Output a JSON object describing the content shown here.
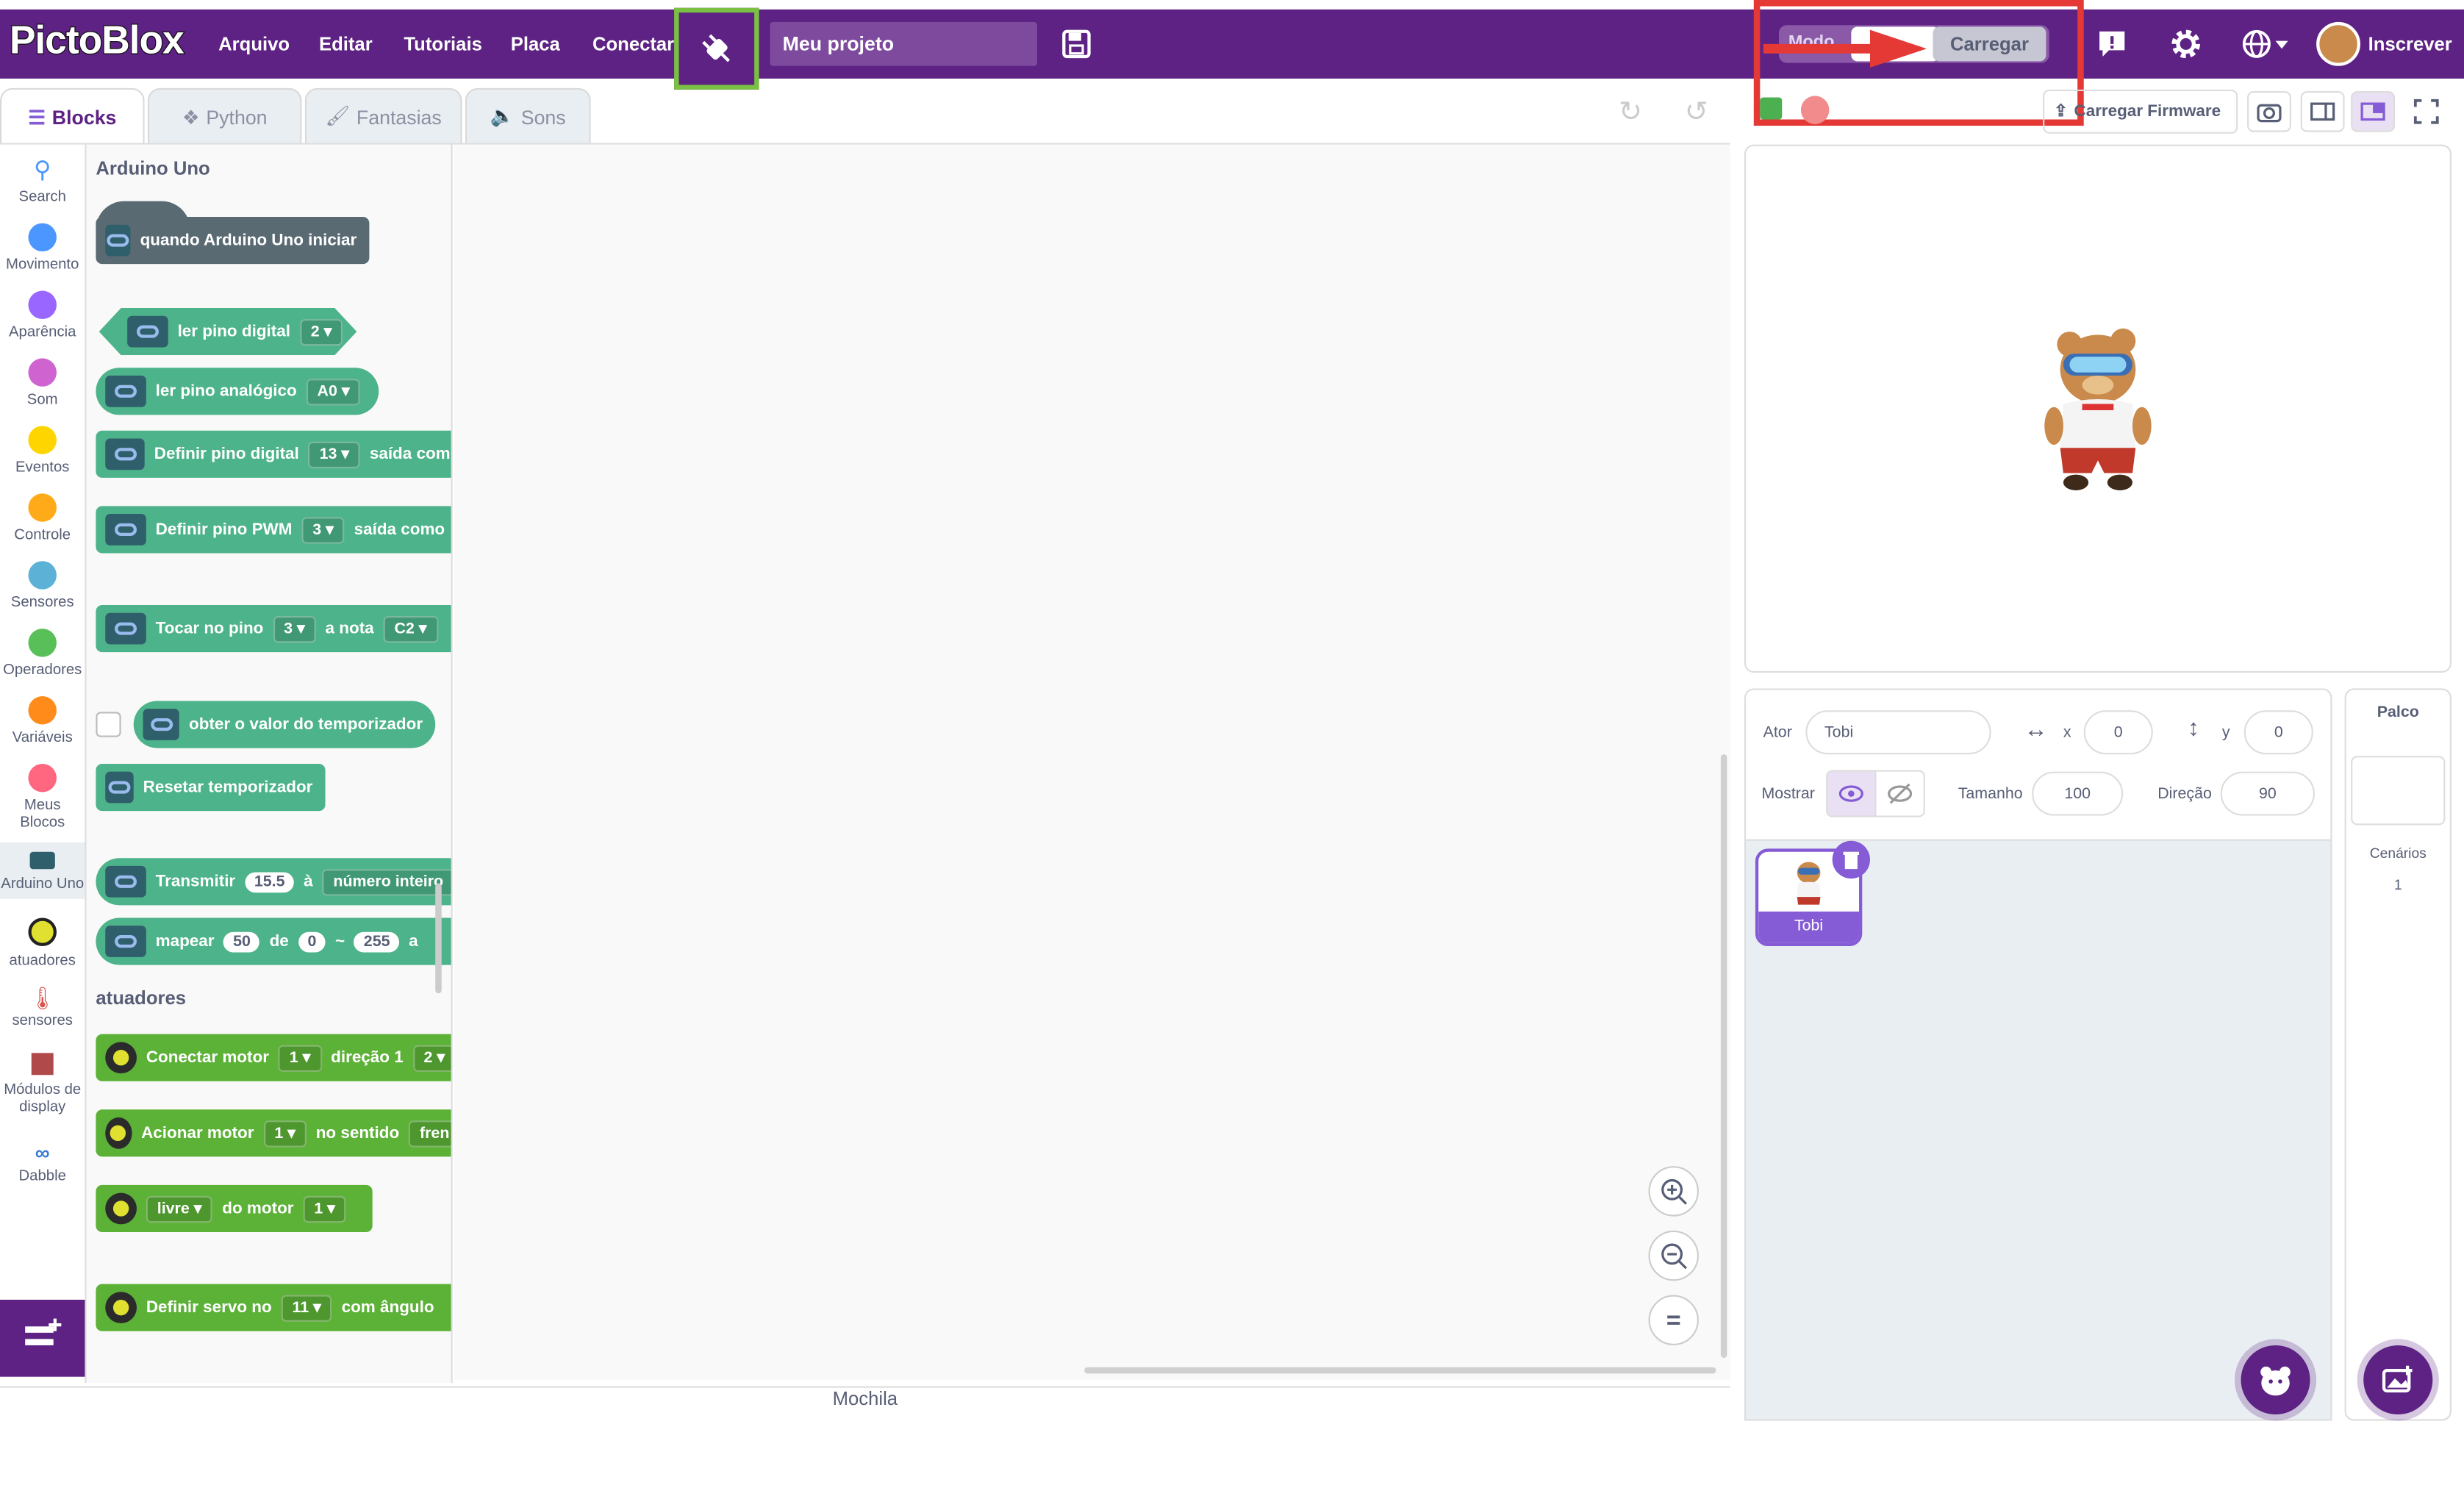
{
  "brand": {
    "logo": "PictoBlox"
  },
  "menu": {
    "file": "Arquivo",
    "edit": "Editar",
    "tutorials": "Tutoriais",
    "board": "Placa",
    "connect": "Conectar"
  },
  "project": {
    "name": "Meu projeto"
  },
  "mode": {
    "label": "Modo",
    "upload": "Carregar"
  },
  "account": {
    "signup": "Inscrever"
  },
  "tabs": {
    "blocks": "Blocks",
    "python": "Python",
    "costumes": "Fantasias",
    "sounds": "Sons"
  },
  "toolbar": {
    "upload_firmware": "Carregar Firmware"
  },
  "categories": [
    {
      "label": "Search",
      "color": "#4c97ff"
    },
    {
      "label": "Movimento",
      "color": "#4c97ff"
    },
    {
      "label": "Aparência",
      "color": "#9966ff"
    },
    {
      "label": "Som",
      "color": "#cf63cf"
    },
    {
      "label": "Eventos",
      "color": "#ffd500"
    },
    {
      "label": "Controle",
      "color": "#ffab19"
    },
    {
      "label": "Sensores",
      "color": "#5cb1d6"
    },
    {
      "label": "Operadores",
      "color": "#59c059"
    },
    {
      "label": "Variáveis",
      "color": "#ff8c1a"
    },
    {
      "label": "Meus Blocos",
      "color": "#ff6680"
    },
    {
      "label": "Arduino Uno",
      "color": "#2f5f6b"
    },
    {
      "label": "atuadores",
      "color": "#e0e030"
    },
    {
      "label": "sensores",
      "color": "#d9534f"
    },
    {
      "label": "Módulos de display",
      "color": "#b04a4a"
    },
    {
      "label": "Dabble",
      "color": "#3a7bd5"
    }
  ],
  "palette": {
    "section_arduino": "Arduino Uno",
    "section_actuators": "atuadores",
    "blocks": {
      "when_start": "quando Arduino Uno iniciar",
      "read_digital": "ler pino digital",
      "read_digital_pin": "2",
      "read_analog": "ler pino analógico",
      "read_analog_pin": "A0",
      "set_digital": "Definir pino digital",
      "set_digital_pin": "13",
      "set_digital_out": "saída como",
      "set_pwm": "Definir pino PWM",
      "set_pwm_pin": "3",
      "set_pwm_out": "saída como",
      "play_tone": "Tocar no pino",
      "play_tone_pin": "3",
      "play_tone_note": "a nota",
      "play_tone_note_val": "C2",
      "timer_value": "obter o valor do temporizador",
      "reset_timer": "Resetar temporizador",
      "transmit": "Transmitir",
      "transmit_val": "15.5",
      "transmit_as": "à",
      "transmit_type": "número inteiro",
      "map": "mapear",
      "map_val": "50",
      "map_from": "de",
      "map_a": "0",
      "map_tilde": "~",
      "map_b": "255",
      "map_to": "a",
      "connect_motor": "Conectar motor",
      "connect_motor_num": "1",
      "connect_motor_dir": "direção 1",
      "connect_motor_dir_val": "2",
      "run_motor": "Acionar motor",
      "run_motor_num": "1",
      "run_motor_sense": "no sentido",
      "run_motor_dir": "fren",
      "free": "livre",
      "free_motor": "do motor",
      "free_motor_num": "1",
      "servo": "Definir servo no",
      "servo_pin": "11",
      "servo_angle": "com ângulo"
    }
  },
  "backpack": {
    "label": "Mochila"
  },
  "sprite_info": {
    "actor_label": "Ator",
    "actor_name": "Tobi",
    "x_label": "x",
    "x_value": "0",
    "y_label": "y",
    "y_value": "0",
    "show_label": "Mostrar",
    "size_label": "Tamanho",
    "size_value": "100",
    "direction_label": "Direção",
    "direction_value": "90"
  },
  "sprites": [
    {
      "name": "Tobi"
    }
  ],
  "stage_panel": {
    "title": "Palco",
    "backdrops_label": "Cenários",
    "backdrops_count": "1"
  }
}
